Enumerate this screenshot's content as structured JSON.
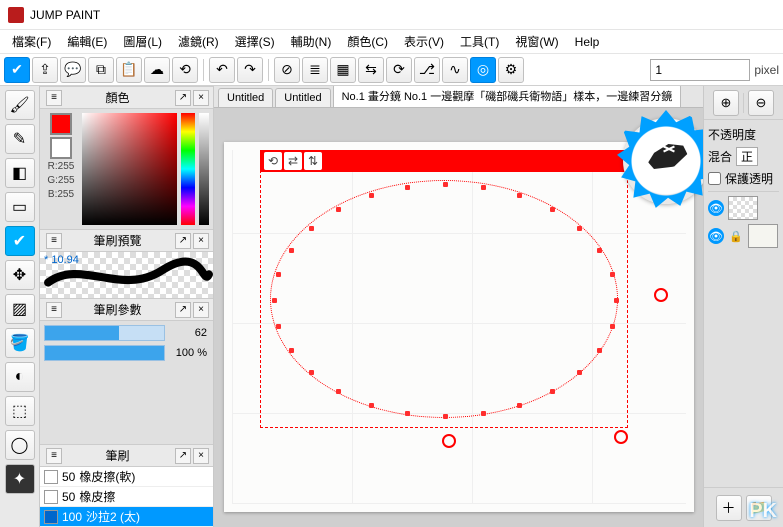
{
  "app": {
    "title": "JUMP PAINT"
  },
  "menu": {
    "file": "檔案(F)",
    "edit": "編輯(E)",
    "layer": "圖層(L)",
    "filter": "濾鏡(R)",
    "select": "選擇(S)",
    "assist": "輔助(N)",
    "color": "顏色(C)",
    "view": "表示(V)",
    "tool": "工具(T)",
    "window": "視窗(W)",
    "help": "Help"
  },
  "toolbar": {
    "unit_value": "1",
    "unit_label": "pixel"
  },
  "panels": {
    "color": {
      "title": "顏色",
      "r": "R:255",
      "g": "G:255",
      "b": "B:255"
    },
    "brush_preview": {
      "title": "筆刷預覽",
      "value": "* 10.94"
    },
    "brush_params": {
      "title": "筆刷參數",
      "size_val": "62",
      "opacity_val": "100 %"
    },
    "brush_list": {
      "title": "筆刷",
      "rows": [
        {
          "size": "50",
          "name": "橡皮擦(軟)"
        },
        {
          "size": "50",
          "name": "橡皮擦"
        },
        {
          "size": "100",
          "name": "沙拉2 (太)"
        }
      ]
    }
  },
  "tabs": {
    "t1": "Untitled",
    "t2": "Untitled",
    "t3": "No.1 畫分鏡 No.1 一邊觀摩「磯部磯兵衛物語」樣本，一邊練習分鏡"
  },
  "right": {
    "opacity_label": "不透明度",
    "blend_label": "混合",
    "protect_label": "保護透明"
  },
  "watermark": "PK"
}
